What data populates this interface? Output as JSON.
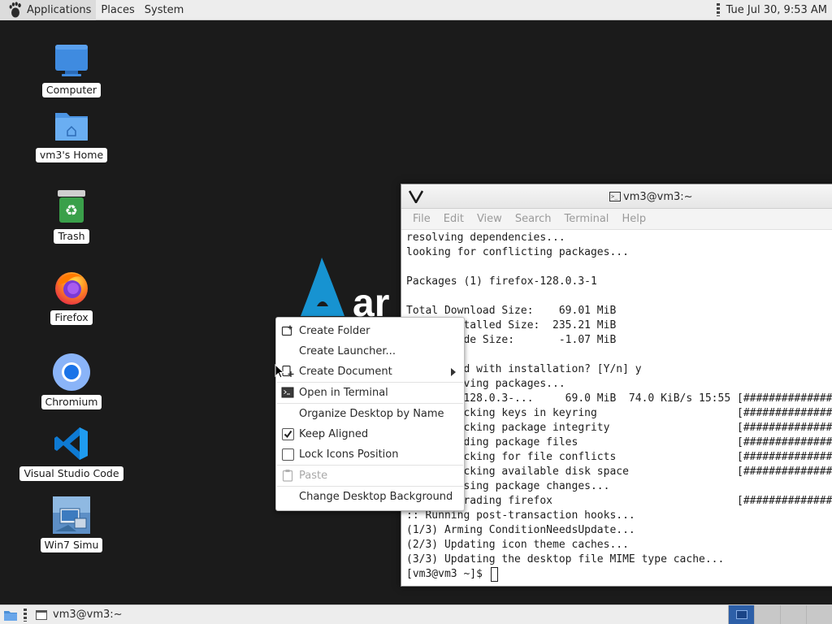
{
  "top_panel": {
    "applications": "Applications",
    "places": "Places",
    "system": "System",
    "clock": "Tue Jul 30,  9:53 AM"
  },
  "desktop_icons": [
    {
      "label": "Computer"
    },
    {
      "label": "vm3's Home"
    },
    {
      "label": "Trash"
    },
    {
      "label": "Firefox"
    },
    {
      "label": "Chromium"
    },
    {
      "label": "Visual Studio Code"
    },
    {
      "label": "Win7 Simu"
    }
  ],
  "terminal": {
    "title": "vm3@vm3:~",
    "menu": [
      "File",
      "Edit",
      "View",
      "Search",
      "Terminal",
      "Help"
    ],
    "lines": [
      "resolving dependencies...",
      "looking for conflicting packages...",
      "",
      "Packages (1) firefox-128.0.3-1",
      "",
      "Total Download Size:    69.01 MiB",
      "Total Installed Size:  235.21 MiB",
      "Net Upgrade Size:       -1.07 MiB",
      "",
      ":: Proceed with installation? [Y/n] y",
      ":: Retrieving packages...",
      " firefox-128.0.3-...     69.0 MiB  74.0 KiB/s 15:55 [##############",
      "(1/1) checking keys in keyring                      [##############",
      "(1/1) checking package integrity                    [##############",
      "(1/1) loading package files                         [##############",
      "(1/1) checking for file conflicts                   [##############",
      "(1/1) checking available disk space                 [##############",
      ":: Processing package changes...",
      "(1/1) upgrading firefox                             [##############",
      ":: Running post-transaction hooks...",
      "(1/3) Arming ConditionNeedsUpdate...",
      "(2/3) Updating icon theme caches...",
      "(3/3) Updating the desktop file MIME type cache..."
    ],
    "prompt": "[vm3@vm3 ~]$ "
  },
  "context_menu": {
    "create_folder": "Create Folder",
    "create_launcher": "Create Launcher...",
    "create_document": "Create Document",
    "open_in_terminal": "Open in Terminal",
    "organize_desktop": "Organize Desktop by Name",
    "keep_aligned": "Keep Aligned",
    "keep_aligned_checked": true,
    "lock_icons": "Lock Icons Position",
    "lock_icons_checked": false,
    "paste": "Paste",
    "change_background": "Change Desktop Background"
  },
  "bottom_panel": {
    "task": "vm3@vm3:~",
    "workspaces_active": 1,
    "workspaces_count": 4
  },
  "colors": {
    "desktop_bg": "#1b1b1b",
    "arch_blue": "#1793d1",
    "workspace_active": "#2d5fa8"
  }
}
